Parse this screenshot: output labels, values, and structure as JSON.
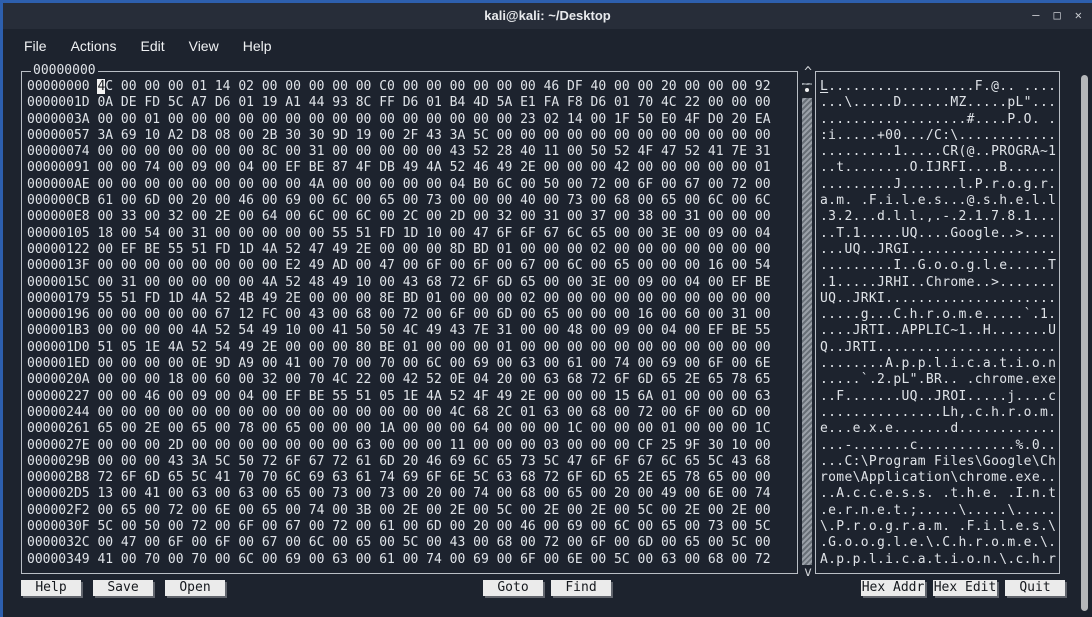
{
  "window": {
    "title": "kali@kali: ~/Desktop",
    "controls": [
      {
        "name": "minimize",
        "glyph": "–"
      },
      {
        "name": "maximize",
        "glyph": "□"
      },
      {
        "name": "close",
        "glyph": "✕"
      }
    ]
  },
  "menu": {
    "items": [
      "File",
      "Actions",
      "Edit",
      "View",
      "Help"
    ]
  },
  "editor": {
    "box_label": "00000000",
    "cursor": {
      "row": 0,
      "col": 0
    },
    "scrollbar": {
      "up_glyph": "^",
      "down_glyph": "v"
    },
    "rows": [
      {
        "addr": "00000000",
        "hex": "4C 00 00 00 01 14 02 00 00 00 00 00 C0 00 00 00 00 00 00 46 DF 40 00 00 20 00 00 00 92"
      },
      {
        "addr": "0000001D",
        "hex": "0A DE FD 5C A7 D6 01 19 A1 44 93 8C FF D6 01 B4 4D 5A E1 FA F8 D6 01 70 4C 22 00 00 00"
      },
      {
        "addr": "0000003A",
        "hex": "00 00 01 00 00 00 00 00 00 00 00 00 00 00 00 00 00 00 23 02 14 00 1F 50 E0 4F D0 20 EA"
      },
      {
        "addr": "00000057",
        "hex": "3A 69 10 A2 D8 08 00 2B 30 30 9D 19 00 2F 43 3A 5C 00 00 00 00 00 00 00 00 00 00 00 00"
      },
      {
        "addr": "00000074",
        "hex": "00 00 00 00 00 00 00 8C 00 31 00 00 00 00 00 43 52 28 40 11 00 50 52 4F 47 52 41 7E 31"
      },
      {
        "addr": "00000091",
        "hex": "00 00 74 00 09 00 04 00 EF BE 87 4F DB 49 4A 52 46 49 2E 00 00 00 42 00 00 00 00 00 01"
      },
      {
        "addr": "000000AE",
        "hex": "00 00 00 00 00 00 00 00 00 4A 00 00 00 00 00 04 B0 6C 00 50 00 72 00 6F 00 67 00 72 00"
      },
      {
        "addr": "000000CB",
        "hex": "61 00 6D 00 20 00 46 00 69 00 6C 00 65 00 73 00 00 00 40 00 73 00 68 00 65 00 6C 00 6C"
      },
      {
        "addr": "000000E8",
        "hex": "00 33 00 32 00 2E 00 64 00 6C 00 6C 00 2C 00 2D 00 32 00 31 00 37 00 38 00 31 00 00 00"
      },
      {
        "addr": "00000105",
        "hex": "18 00 54 00 31 00 00 00 00 00 55 51 FD 1D 10 00 47 6F 6F 67 6C 65 00 00 3E 00 09 00 04"
      },
      {
        "addr": "00000122",
        "hex": "00 EF BE 55 51 FD 1D 4A 52 47 49 2E 00 00 00 8D BD 01 00 00 00 02 00 00 00 00 00 00 00"
      },
      {
        "addr": "0000013F",
        "hex": "00 00 00 00 00 00 00 00 E2 49 AD 00 47 00 6F 00 6F 00 67 00 6C 00 65 00 00 00 16 00 54"
      },
      {
        "addr": "0000015C",
        "hex": "00 31 00 00 00 00 00 4A 52 48 49 10 00 43 68 72 6F 6D 65 00 00 3E 00 09 00 04 00 EF BE"
      },
      {
        "addr": "00000179",
        "hex": "55 51 FD 1D 4A 52 4B 49 2E 00 00 00 8E BD 01 00 00 00 02 00 00 00 00 00 00 00 00 00 00"
      },
      {
        "addr": "00000196",
        "hex": "00 00 00 00 00 67 12 FC 00 43 00 68 00 72 00 6F 00 6D 00 65 00 00 00 16 00 60 00 31 00"
      },
      {
        "addr": "000001B3",
        "hex": "00 00 00 00 4A 52 54 49 10 00 41 50 50 4C 49 43 7E 31 00 00 48 00 09 00 04 00 EF BE 55"
      },
      {
        "addr": "000001D0",
        "hex": "51 05 1E 4A 52 54 49 2E 00 00 00 80 BE 01 00 00 00 01 00 00 00 00 00 00 00 00 00 00 00"
      },
      {
        "addr": "000001ED",
        "hex": "00 00 00 00 0E 9D A9 00 41 00 70 00 70 00 6C 00 69 00 63 00 61 00 74 00 69 00 6F 00 6E"
      },
      {
        "addr": "0000020A",
        "hex": "00 00 00 18 00 60 00 32 00 70 4C 22 00 42 52 0E 04 20 00 63 68 72 6F 6D 65 2E 65 78 65"
      },
      {
        "addr": "00000227",
        "hex": "00 00 46 00 09 00 04 00 EF BE 55 51 05 1E 4A 52 4F 49 2E 00 00 00 15 6A 01 00 00 00 63"
      },
      {
        "addr": "00000244",
        "hex": "00 00 00 00 00 00 00 00 00 00 00 00 00 00 00 4C 68 2C 01 63 00 68 00 72 00 6F 00 6D 00"
      },
      {
        "addr": "00000261",
        "hex": "65 00 2E 00 65 00 78 00 65 00 00 00 1A 00 00 00 64 00 00 00 1C 00 00 00 01 00 00 00 1C"
      },
      {
        "addr": "0000027E",
        "hex": "00 00 00 2D 00 00 00 00 00 00 00 63 00 00 00 11 00 00 00 03 00 00 00 CF 25 9F 30 10 00"
      },
      {
        "addr": "0000029B",
        "hex": "00 00 00 43 3A 5C 50 72 6F 67 72 61 6D 20 46 69 6C 65 73 5C 47 6F 6F 67 6C 65 5C 43 68"
      },
      {
        "addr": "000002B8",
        "hex": "72 6F 6D 65 5C 41 70 70 6C 69 63 61 74 69 6F 6E 5C 63 68 72 6F 6D 65 2E 65 78 65 00 00"
      },
      {
        "addr": "000002D5",
        "hex": "13 00 41 00 63 00 63 00 65 00 73 00 73 00 20 00 74 00 68 00 65 00 20 00 49 00 6E 00 74"
      },
      {
        "addr": "000002F2",
        "hex": "00 65 00 72 00 6E 00 65 00 74 00 3B 00 2E 00 2E 00 5C 00 2E 00 2E 00 5C 00 2E 00 2E 00"
      },
      {
        "addr": "0000030F",
        "hex": "5C 00 50 00 72 00 6F 00 67 00 72 00 61 00 6D 00 20 00 46 00 69 00 6C 00 65 00 73 00 5C"
      },
      {
        "addr": "0000032C",
        "hex": "00 47 00 6F 00 6F 00 67 00 6C 00 65 00 5C 00 43 00 68 00 72 00 6F 00 6D 00 65 00 5C 00"
      },
      {
        "addr": "00000349",
        "hex": "41 00 70 00 70 00 6C 00 69 00 63 00 61 00 74 00 69 00 6F 00 6E 00 5C 00 63 00 68 00 72"
      }
    ]
  },
  "buttons": {
    "left": [
      "Help",
      "Save",
      "Open"
    ],
    "center": [
      "Goto",
      "Find"
    ],
    "right": [
      "Hex Addr",
      "Hex Edit",
      "Quit"
    ]
  },
  "colors": {
    "accent_border": "#2d5fae",
    "titlebar_bg": "#272d39",
    "terminal_bg": "#1d232e",
    "text": "#dfe3e8",
    "panel_border": "#b9bec5",
    "button_bg": "#ebebeb",
    "cursor_bg": "#f2f2f2"
  }
}
